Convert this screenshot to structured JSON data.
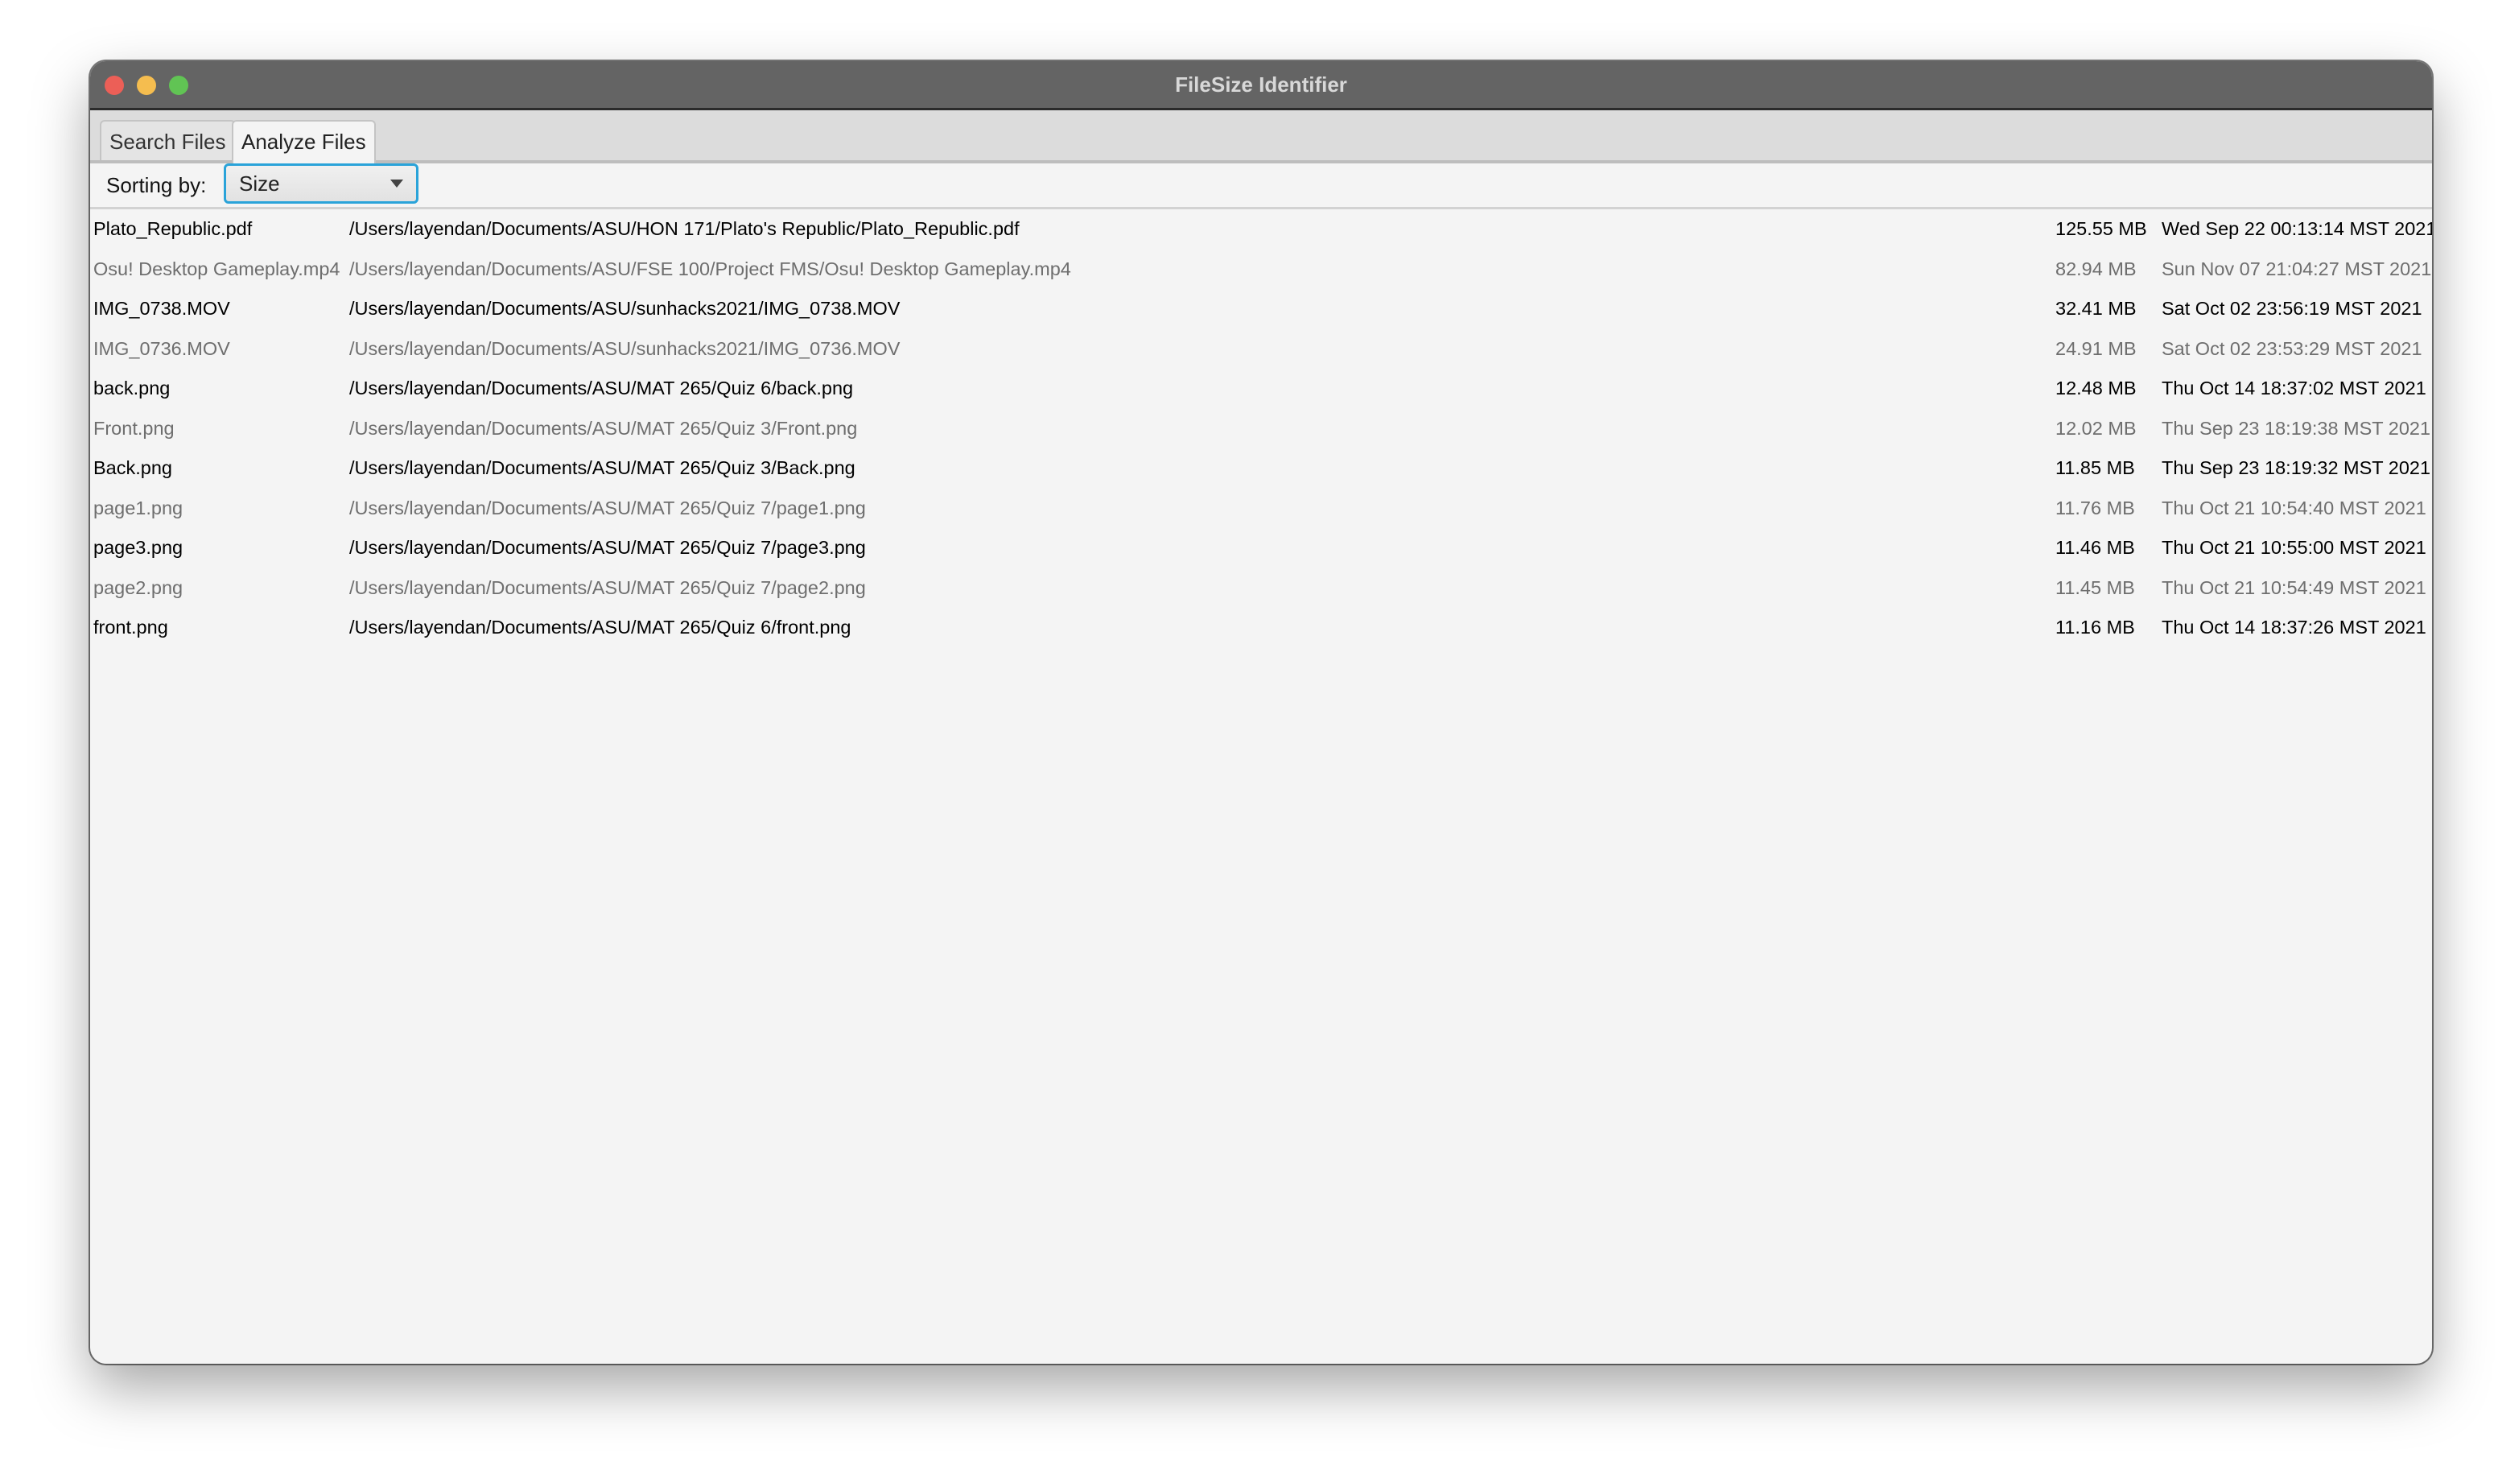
{
  "window": {
    "title": "FileSize Identifier"
  },
  "tabs": [
    {
      "label": "Search Files",
      "active": false
    },
    {
      "label": "Analyze Files",
      "active": true
    }
  ],
  "sorting": {
    "label": "Sorting by:",
    "selected": "Size"
  },
  "colors": {
    "accent": "#2aa3d9",
    "titlebar": "#646464",
    "close": "#ec5f57",
    "minimize": "#f5bd4f",
    "zoom": "#61c454"
  },
  "files": [
    {
      "name": "Plato_Republic.pdf",
      "path": "/Users/layendan/Documents/ASU/HON 171/Plato's Republic/Plato_Republic.pdf",
      "size": "125.55 MB",
      "date": "Wed Sep 22 00:13:14 MST 2021"
    },
    {
      "name": "Osu! Desktop Gameplay.mp4",
      "path": "/Users/layendan/Documents/ASU/FSE 100/Project FMS/Osu! Desktop Gameplay.mp4",
      "size": "82.94 MB",
      "date": "Sun Nov 07 21:04:27 MST 2021"
    },
    {
      "name": "IMG_0738.MOV",
      "path": "/Users/layendan/Documents/ASU/sunhacks2021/IMG_0738.MOV",
      "size": "32.41 MB",
      "date": "Sat Oct 02 23:56:19 MST 2021"
    },
    {
      "name": "IMG_0736.MOV",
      "path": "/Users/layendan/Documents/ASU/sunhacks2021/IMG_0736.MOV",
      "size": "24.91 MB",
      "date": "Sat Oct 02 23:53:29 MST 2021"
    },
    {
      "name": "back.png",
      "path": "/Users/layendan/Documents/ASU/MAT 265/Quiz 6/back.png",
      "size": "12.48 MB",
      "date": "Thu Oct 14 18:37:02 MST 2021"
    },
    {
      "name": "Front.png",
      "path": "/Users/layendan/Documents/ASU/MAT 265/Quiz 3/Front.png",
      "size": "12.02 MB",
      "date": "Thu Sep 23 18:19:38 MST 2021"
    },
    {
      "name": "Back.png",
      "path": "/Users/layendan/Documents/ASU/MAT 265/Quiz 3/Back.png",
      "size": "11.85 MB",
      "date": "Thu Sep 23 18:19:32 MST 2021"
    },
    {
      "name": "page1.png",
      "path": "/Users/layendan/Documents/ASU/MAT 265/Quiz 7/page1.png",
      "size": "11.76 MB",
      "date": "Thu Oct 21 10:54:40 MST 2021"
    },
    {
      "name": "page3.png",
      "path": "/Users/layendan/Documents/ASU/MAT 265/Quiz 7/page3.png",
      "size": "11.46 MB",
      "date": "Thu Oct 21 10:55:00 MST 2021"
    },
    {
      "name": "page2.png",
      "path": "/Users/layendan/Documents/ASU/MAT 265/Quiz 7/page2.png",
      "size": "11.45 MB",
      "date": "Thu Oct 21 10:54:49 MST 2021"
    },
    {
      "name": "front.png",
      "path": "/Users/layendan/Documents/ASU/MAT 265/Quiz 6/front.png",
      "size": "11.16 MB",
      "date": "Thu Oct 14 18:37:26 MST 2021"
    }
  ]
}
